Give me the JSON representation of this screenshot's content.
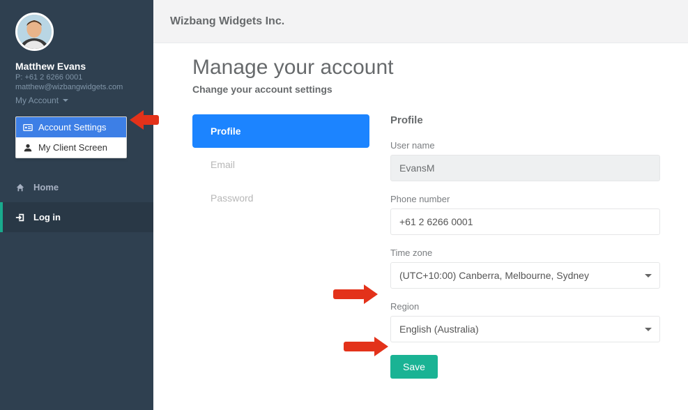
{
  "sidebar": {
    "user": {
      "name": "Matthew Evans",
      "phone": "P: +61 2 6266 0001",
      "email": "matthew@wizbangwidgets.com"
    },
    "my_account_label": "My Account",
    "dropdown": {
      "account_settings": "Account Settings",
      "my_client_screen": "My Client Screen"
    },
    "nav": {
      "home": "Home",
      "login": "Log in"
    }
  },
  "topbar": {
    "brand": "Wizbang Widgets Inc."
  },
  "page": {
    "title": "Manage your account",
    "subtitle": "Change your account settings"
  },
  "tabs": {
    "profile": "Profile",
    "email": "Email",
    "password": "Password"
  },
  "form": {
    "panel_title": "Profile",
    "username_label": "User name",
    "username_value": "EvansM",
    "phone_label": "Phone number",
    "phone_value": "+61 2 6266 0001",
    "timezone_label": "Time zone",
    "timezone_value": "(UTC+10:00) Canberra, Melbourne, Sydney",
    "region_label": "Region",
    "region_value": "English (Australia)",
    "save_label": "Save"
  }
}
